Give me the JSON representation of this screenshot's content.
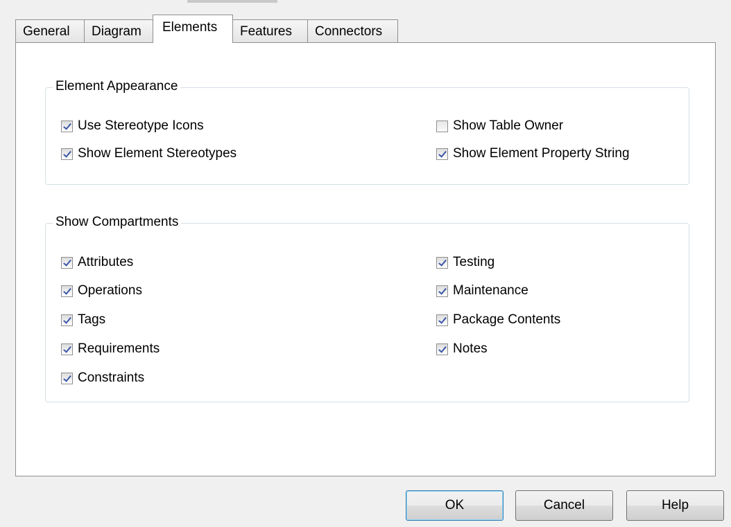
{
  "tabs": [
    {
      "label": "General",
      "active": false
    },
    {
      "label": "Diagram",
      "active": false
    },
    {
      "label": "Elements",
      "active": true
    },
    {
      "label": "Features",
      "active": false
    },
    {
      "label": "Connectors",
      "active": false
    }
  ],
  "element_appearance": {
    "legend": "Element Appearance",
    "options": [
      {
        "label": "Use Stereotype Icons",
        "checked": true
      },
      {
        "label": "Show Element Stereotypes",
        "checked": true
      },
      {
        "label": "Show Table Owner",
        "checked": false
      },
      {
        "label": "Show Element Property String",
        "checked": true
      }
    ]
  },
  "show_compartments": {
    "legend": "Show Compartments",
    "options": [
      {
        "label": "Attributes",
        "checked": true
      },
      {
        "label": "Operations",
        "checked": true
      },
      {
        "label": "Tags",
        "checked": true
      },
      {
        "label": "Requirements",
        "checked": true
      },
      {
        "label": "Constraints",
        "checked": true
      },
      {
        "label": "Testing",
        "checked": true
      },
      {
        "label": "Maintenance",
        "checked": true
      },
      {
        "label": "Package Contents",
        "checked": true
      },
      {
        "label": "Notes",
        "checked": true
      }
    ]
  },
  "buttons": {
    "ok": "OK",
    "cancel": "Cancel",
    "help": "Help"
  },
  "colors": {
    "dialog_bg": "#f0f0f0",
    "page_bg": "#ffffff",
    "check_mark": "#3c57a8",
    "group_border": "#d5dfe5"
  }
}
